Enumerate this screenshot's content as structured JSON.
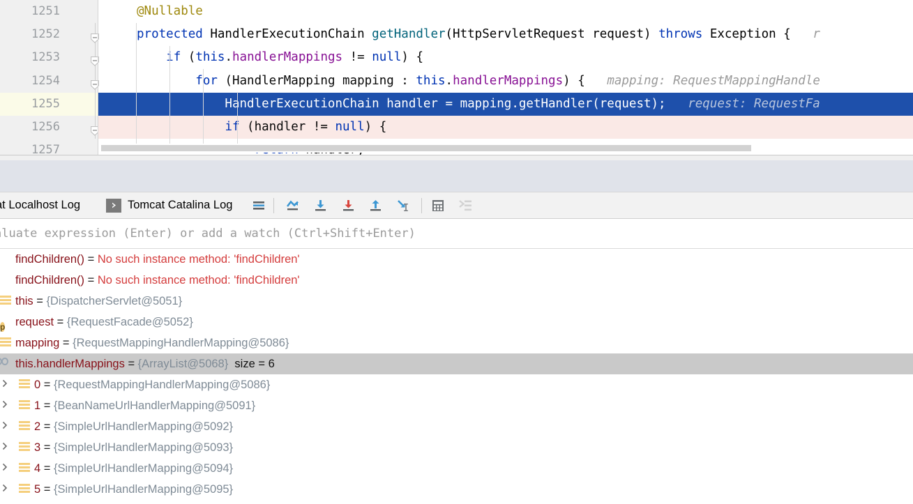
{
  "editor": {
    "lines": [
      {
        "num": "1251",
        "state": "normal",
        "fold": false,
        "icon": "none",
        "indent": 0,
        "tokens": [
          {
            "t": "@Nullable",
            "c": "anno"
          }
        ]
      },
      {
        "num": "1252",
        "state": "normal",
        "fold": true,
        "icon": "run-to-cursor-icon",
        "indent": 0,
        "tokens": [
          {
            "t": "protected ",
            "c": "kw"
          },
          {
            "t": "HandlerExecutionChain ",
            "c": "cls"
          },
          {
            "t": "getHandler",
            "c": "mth"
          },
          {
            "t": "(HttpServletRequest request) ",
            "c": "cls"
          },
          {
            "t": "throws ",
            "c": "kw"
          },
          {
            "t": "Exception {",
            "c": "cls"
          },
          {
            "t": "   r",
            "c": "hint"
          }
        ]
      },
      {
        "num": "1253",
        "state": "normal",
        "fold": true,
        "icon": "none",
        "indent": 1,
        "tokens": [
          {
            "t": "    ",
            "c": "pln"
          },
          {
            "t": "if",
            "c": "kw"
          },
          {
            "t": " (",
            "c": "pln"
          },
          {
            "t": "this",
            "c": "kw"
          },
          {
            "t": ".",
            "c": "pln"
          },
          {
            "t": "handlerMappings",
            "c": "fld"
          },
          {
            "t": " != ",
            "c": "pln"
          },
          {
            "t": "null",
            "c": "kw"
          },
          {
            "t": ") {",
            "c": "pln"
          }
        ]
      },
      {
        "num": "1254",
        "state": "normal",
        "fold": true,
        "icon": "none",
        "indent": 2,
        "tokens": [
          {
            "t": "        ",
            "c": "pln"
          },
          {
            "t": "for",
            "c": "kw"
          },
          {
            "t": " (HandlerMapping mapping : ",
            "c": "pln"
          },
          {
            "t": "this",
            "c": "kw"
          },
          {
            "t": ".",
            "c": "pln"
          },
          {
            "t": "handlerMappings",
            "c": "fld"
          },
          {
            "t": ") {",
            "c": "pln"
          },
          {
            "t": "   mapping: RequestMappingHandle",
            "c": "hint"
          }
        ]
      },
      {
        "num": "1255",
        "state": "exec",
        "fold": false,
        "icon": "breakpoint-verified-icon",
        "indent": 3,
        "tokens": [
          {
            "t": "            HandlerExecutionChain handler = mapping.",
            "c": "pln"
          },
          {
            "t": "getHandler",
            "c": "mth"
          },
          {
            "t": "(request);",
            "c": "pln"
          },
          {
            "t": "   request: RequestFa",
            "c": "hint"
          }
        ]
      },
      {
        "num": "1256",
        "state": "bp",
        "fold": true,
        "icon": "breakpoint-verified-icon",
        "indent": 3,
        "tokens": [
          {
            "t": "            ",
            "c": "pln"
          },
          {
            "t": "if",
            "c": "kw"
          },
          {
            "t": " (handler != ",
            "c": "pln"
          },
          {
            "t": "null",
            "c": "kw"
          },
          {
            "t": ") {",
            "c": "pln"
          }
        ]
      },
      {
        "num": "1257",
        "state": "normal",
        "fold": false,
        "icon": "none",
        "indent": 4,
        "tokens": [
          {
            "t": "                ",
            "c": "pln"
          },
          {
            "t": "return",
            "c": "kw"
          },
          {
            "t": " handler;",
            "c": "pln"
          }
        ]
      }
    ]
  },
  "toolbar": {
    "tab_localhost_log": "at Localhost Log",
    "tab_catalina_log": "Tomcat Catalina Log",
    "run_glyph": "❯",
    "buttons": [
      {
        "name": "show-execution-point-icon",
        "label": "≡"
      },
      {
        "name": "step-over-icon",
        "label": "step over"
      },
      {
        "name": "step-into-icon",
        "label": "step into"
      },
      {
        "name": "force-step-into-icon",
        "label": "force step into"
      },
      {
        "name": "step-out-icon",
        "label": "step out"
      },
      {
        "name": "run-to-cursor-icon",
        "label": "run to cursor"
      },
      {
        "name": "evaluate-expression-icon",
        "label": "evaluate expression"
      },
      {
        "name": "trace-current-stream-chain-icon",
        "label": "trace stream chain"
      }
    ]
  },
  "evaluate": {
    "placeholder": "aluate expression (Enter) or add a watch (Ctrl+Shift+Enter)"
  },
  "variables": {
    "rows": [
      {
        "icon": "error-icon",
        "arrow": false,
        "indent": 0,
        "name": "findChildren()",
        "eq": " = ",
        "value": "No such instance method: 'findChildren'",
        "value_class": "verr",
        "extra": "",
        "selected": false
      },
      {
        "icon": "error-icon",
        "arrow": false,
        "indent": 0,
        "name": "findChildren()",
        "eq": " = ",
        "value": "No such instance method: 'findChildren'",
        "value_class": "verr",
        "extra": "",
        "selected": false
      },
      {
        "icon": "list-icon",
        "arrow": false,
        "indent": 0,
        "name": "this",
        "eq": " = ",
        "value": "{DispatcherServlet@5051}",
        "value_class": "vval",
        "extra": "",
        "selected": false
      },
      {
        "icon": "parameter-icon",
        "arrow": false,
        "indent": 0,
        "name": "request",
        "eq": " = ",
        "value": "{RequestFacade@5052}",
        "value_class": "vval",
        "extra": "",
        "selected": false
      },
      {
        "icon": "list-icon",
        "arrow": false,
        "indent": 0,
        "name": "mapping",
        "eq": " = ",
        "value": "{RequestMappingHandlerMapping@5086}",
        "value_class": "vval",
        "extra": "",
        "selected": false
      },
      {
        "icon": "watch-icon",
        "arrow": false,
        "indent": 0,
        "name": "this.handlerMappings",
        "eq": " = ",
        "value": "{ArrayList@5068}",
        "value_class": "vval",
        "extra": "size = 6",
        "selected": true
      },
      {
        "icon": "list-icon",
        "arrow": true,
        "indent": 1,
        "name": "0",
        "eq": " = ",
        "value": "{RequestMappingHandlerMapping@5086}",
        "value_class": "vval",
        "extra": "",
        "selected": false
      },
      {
        "icon": "list-icon",
        "arrow": true,
        "indent": 1,
        "name": "1",
        "eq": " = ",
        "value": "{BeanNameUrlHandlerMapping@5091}",
        "value_class": "vval",
        "extra": "",
        "selected": false
      },
      {
        "icon": "list-icon",
        "arrow": true,
        "indent": 1,
        "name": "2",
        "eq": " = ",
        "value": "{SimpleUrlHandlerMapping@5092}",
        "value_class": "vval",
        "extra": "",
        "selected": false
      },
      {
        "icon": "list-icon",
        "arrow": true,
        "indent": 1,
        "name": "3",
        "eq": " = ",
        "value": "{SimpleUrlHandlerMapping@5093}",
        "value_class": "vval",
        "extra": "",
        "selected": false
      },
      {
        "icon": "list-icon",
        "arrow": true,
        "indent": 1,
        "name": "4",
        "eq": " = ",
        "value": "{SimpleUrlHandlerMapping@5094}",
        "value_class": "vval",
        "extra": "",
        "selected": false
      },
      {
        "icon": "list-icon",
        "arrow": true,
        "indent": 1,
        "name": "5",
        "eq": " = ",
        "value": "{SimpleUrlHandlerMapping@5095}",
        "value_class": "vval",
        "extra": "",
        "selected": false
      }
    ],
    "expand_arrow_glyph": "❯"
  },
  "colors": {
    "execution_line": "#1e50ab",
    "breakpoint_line": "#fae9e6",
    "breakpoint_red": "#db5c5c",
    "error_red": "#d43c3c",
    "var_name": "#871018",
    "var_value": "#7f8b96",
    "panel_blue_gray": "#e0e3ea",
    "accent_blue": "#3c97d3"
  }
}
